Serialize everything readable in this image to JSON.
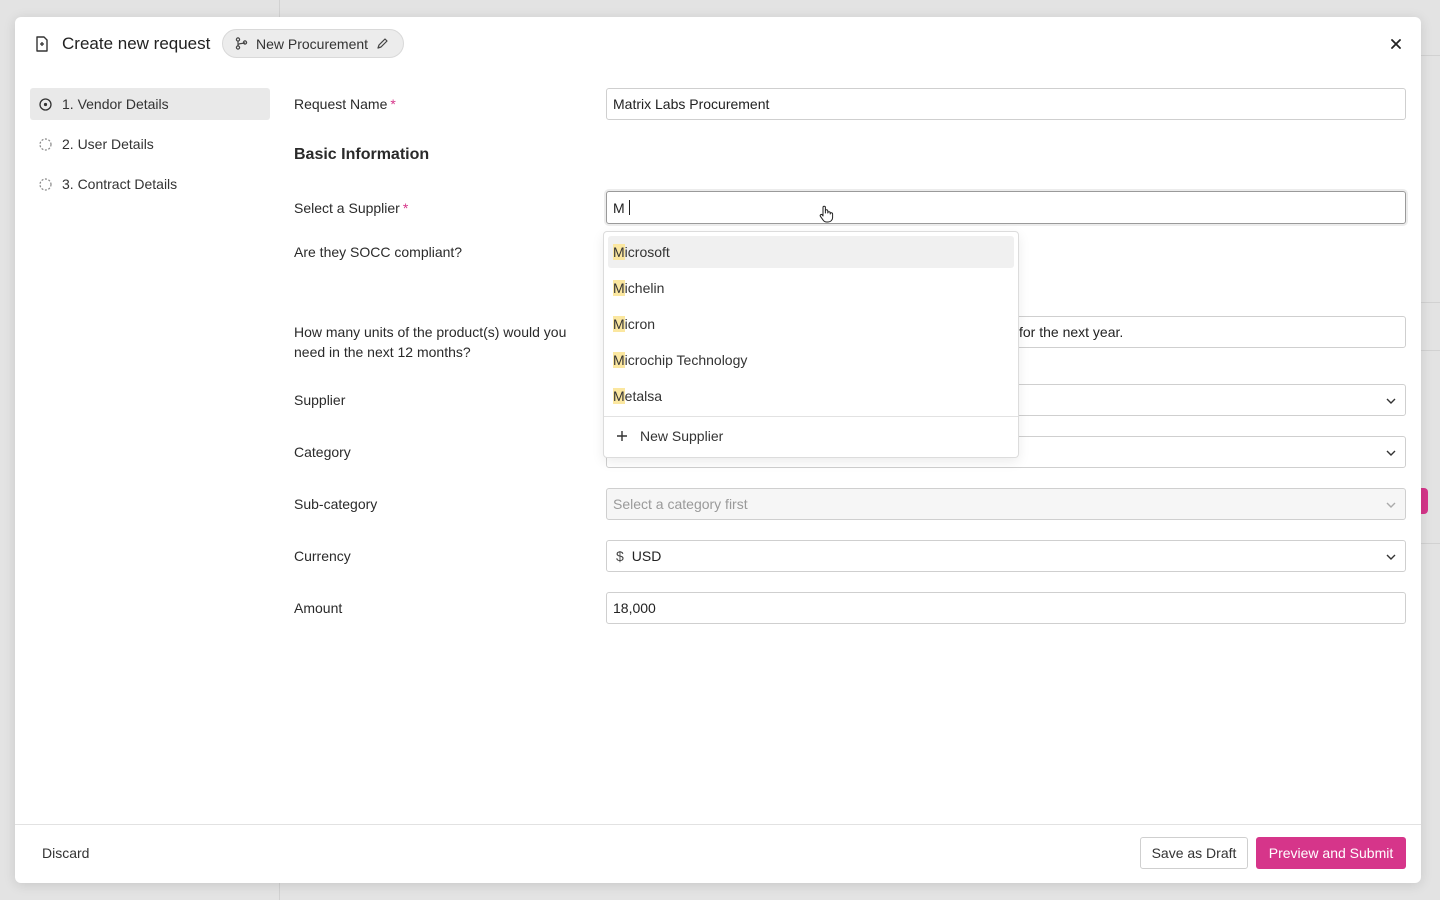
{
  "header": {
    "title": "Create new request",
    "chip_label": "New Procurement"
  },
  "steps": [
    {
      "label": "1. Vendor Details",
      "active": true
    },
    {
      "label": "2. User Details",
      "active": false
    },
    {
      "label": "3. Contract Details",
      "active": false
    }
  ],
  "form": {
    "request_name_label": "Request Name",
    "request_name_value": "Matrix Labs Procurement",
    "section_title": "Basic Information",
    "supplier_select_label": "Select a Supplier",
    "supplier_search_value": "M",
    "socc_label": "Are they SOCC compliant?",
    "units_label": "How many units of the product(s) would you need in the next 12 months?",
    "units_value_visible": "for the next year.",
    "supplier_label": "Supplier",
    "category_label": "Category",
    "subcategory_label": "Sub-category",
    "subcategory_placeholder": "Select a category first",
    "currency_label": "Currency",
    "currency_symbol": "$",
    "currency_value": "USD",
    "amount_label": "Amount",
    "amount_value": "18,000",
    "required_marker": "*"
  },
  "dropdown": {
    "options": [
      {
        "match": "M",
        "rest": "icrosoft"
      },
      {
        "match": "M",
        "rest": "ichelin"
      },
      {
        "match": "M",
        "rest": "icron"
      },
      {
        "match": "M",
        "rest": "icrochip Technology"
      },
      {
        "match": "M",
        "rest": "etalsa"
      }
    ],
    "new_label": "New Supplier"
  },
  "footer": {
    "discard": "Discard",
    "save_draft": "Save as Draft",
    "submit": "Preview and Submit"
  },
  "colors": {
    "accent": "#d6358a",
    "highlight": "#fbe7a0"
  }
}
